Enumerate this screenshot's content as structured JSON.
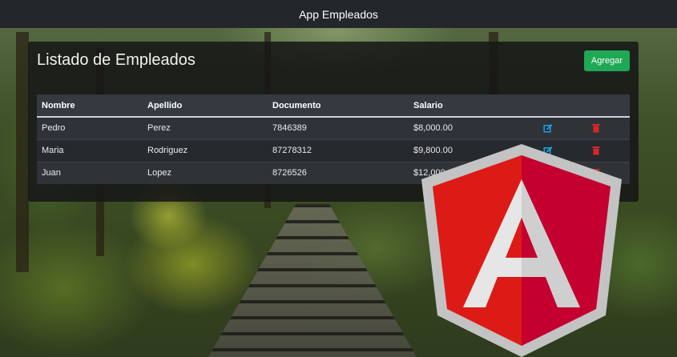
{
  "navbar": {
    "title": "App Empleados"
  },
  "panel": {
    "title": "Listado de Empleados",
    "add_label": "Agregar"
  },
  "table": {
    "headers": [
      "Nombre",
      "Apellido",
      "Documento",
      "Salario"
    ],
    "rows": [
      {
        "nombre": "Pedro",
        "apellido": "Perez",
        "documento": "7846389",
        "salario": "$8,000.00"
      },
      {
        "nombre": "Maria",
        "apellido": "Rodriguez",
        "documento": "87278312",
        "salario": "$9,800.00"
      },
      {
        "nombre": "Juan",
        "apellido": "Lopez",
        "documento": "8726526",
        "salario": "$12,000.00"
      }
    ]
  },
  "icons": {
    "edit": "edit-icon",
    "delete": "trash-icon"
  },
  "colors": {
    "navbar": "#23272b",
    "add_button": "#1fa855",
    "edit_icon": "#1ea0e6",
    "delete_icon": "#d9262a",
    "logo_red": "#dd1b16",
    "logo_dark_red": "#c3002f"
  }
}
